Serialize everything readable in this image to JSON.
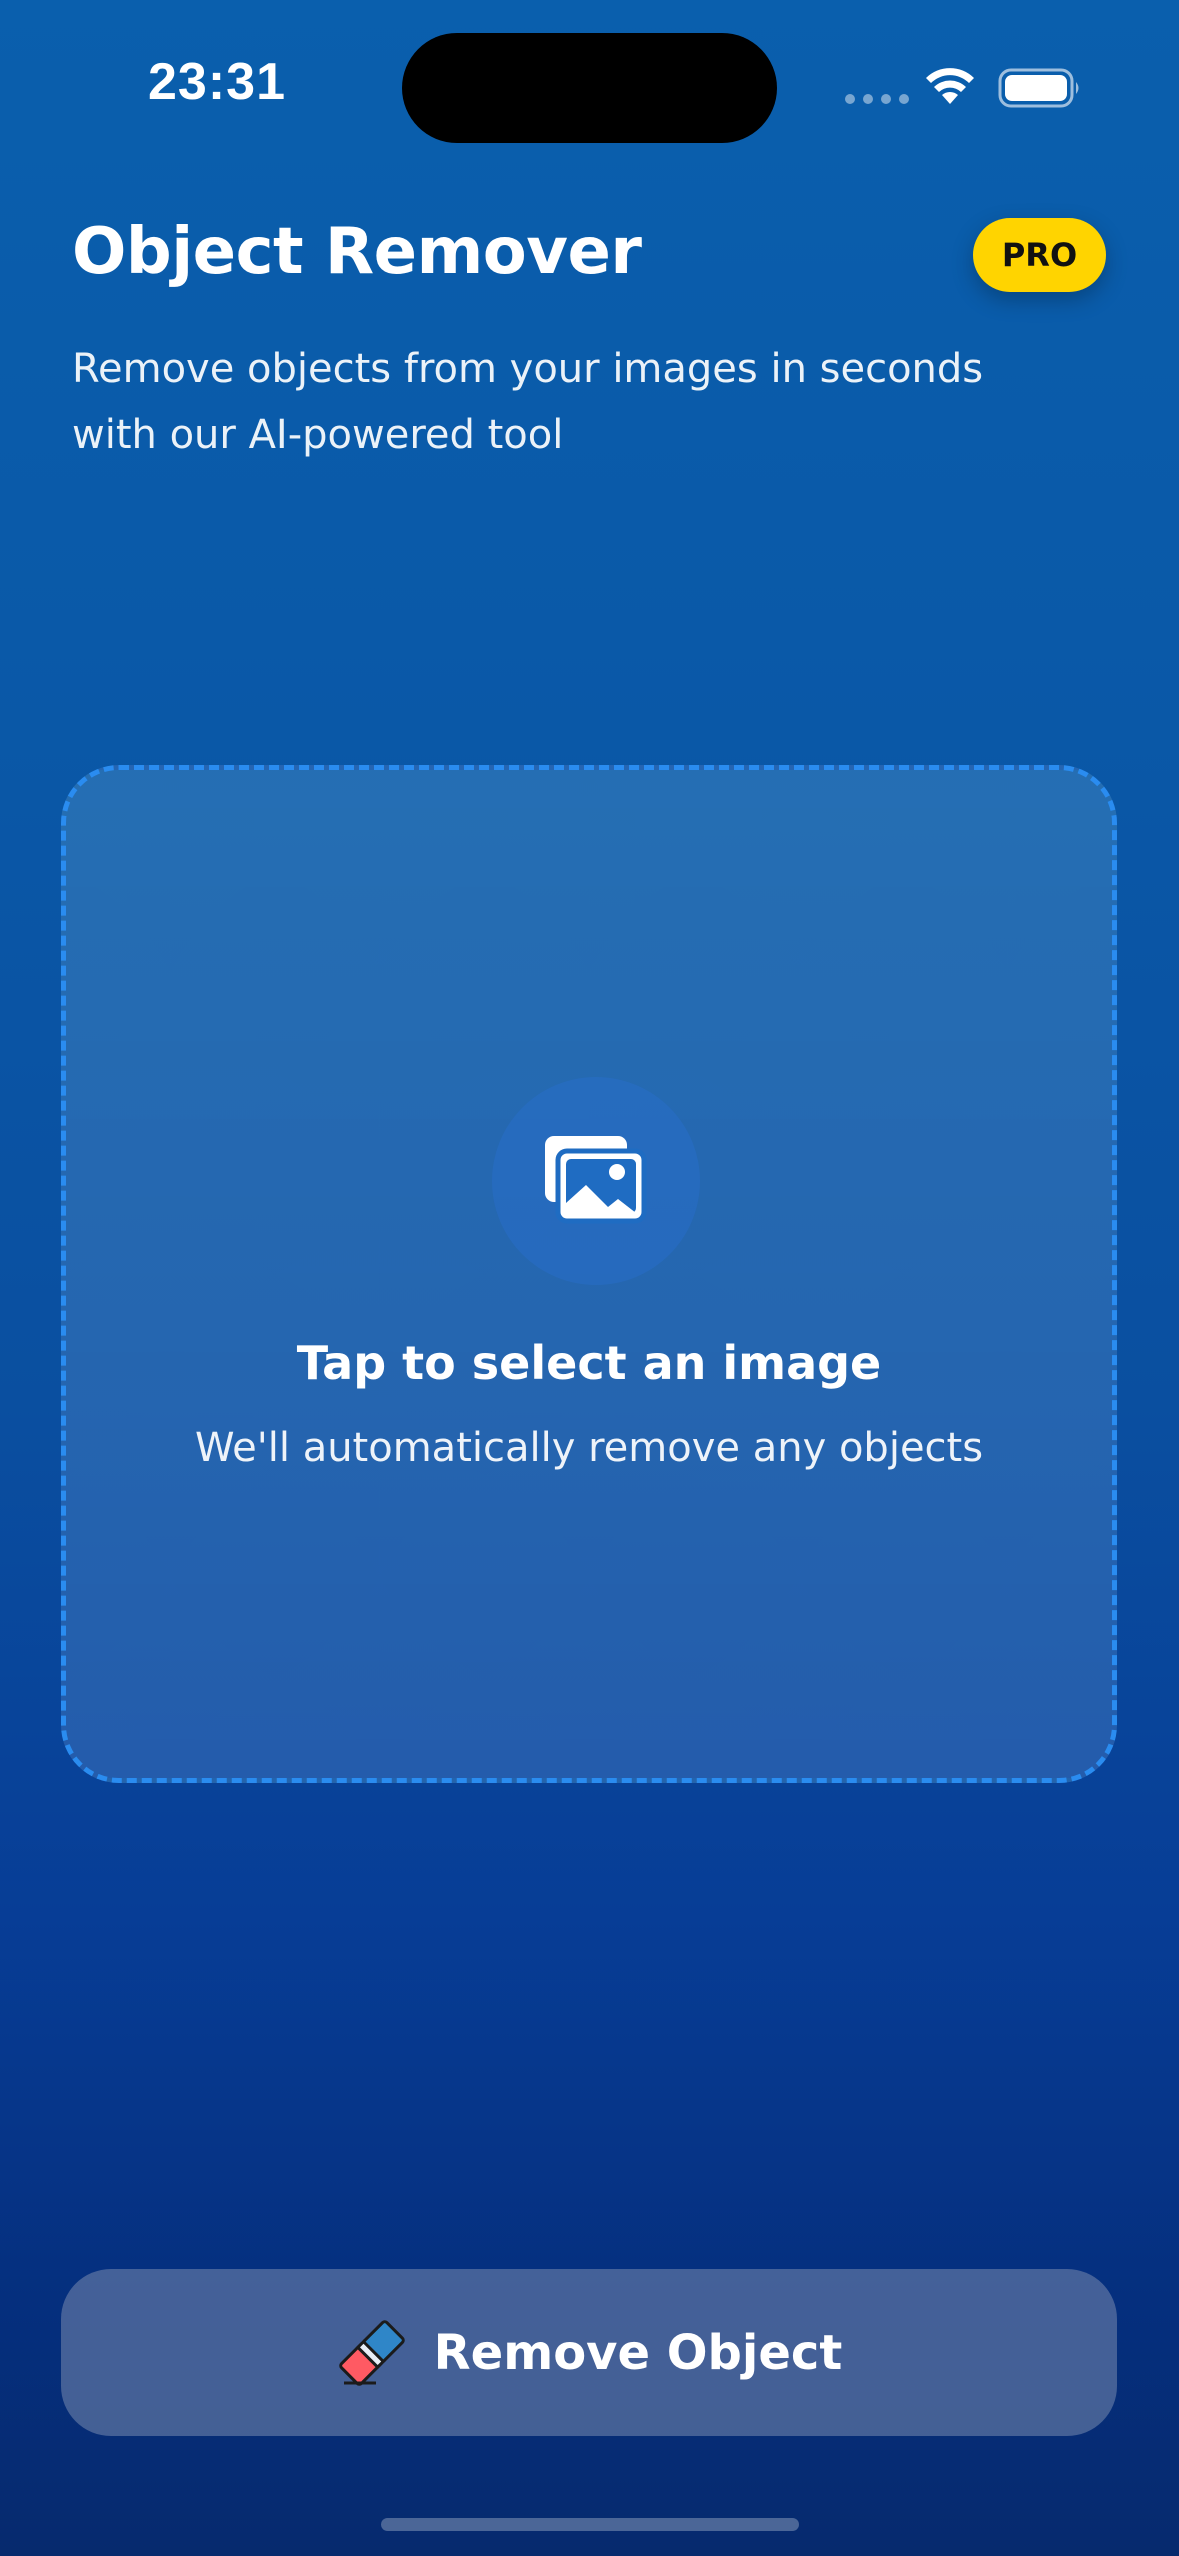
{
  "status_bar": {
    "time": "23:31"
  },
  "header": {
    "title": "Object Remover",
    "badge": "PRO",
    "subtitle_line1": "Remove objects from your images in seconds",
    "subtitle_line2": "with our AI-powered tool"
  },
  "drop_zone": {
    "icon": "image-icon",
    "title": "Tap to select an image",
    "subtitle": "We'll automatically remove any objects"
  },
  "action_button": {
    "icon": "eraser-icon",
    "label": "Remove Object"
  },
  "colors": {
    "background_top": "#0a5fad",
    "background_bottom": "#062a6e",
    "badge": "#ffd400",
    "dashed_border": "#2a8cf0"
  }
}
